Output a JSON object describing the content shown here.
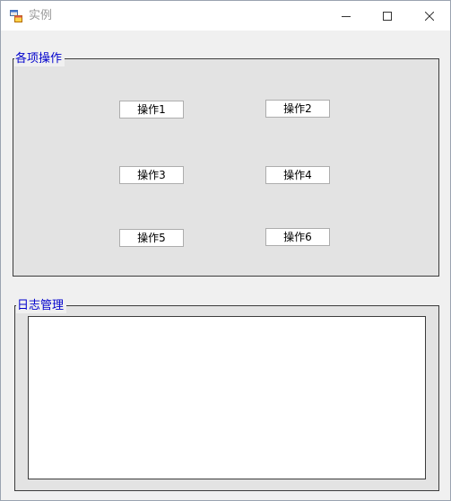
{
  "window": {
    "title": "实例"
  },
  "operations_group": {
    "legend": "各项操作",
    "buttons": [
      {
        "label": "操作1"
      },
      {
        "label": "操作2"
      },
      {
        "label": "操作3"
      },
      {
        "label": "操作4"
      },
      {
        "label": "操作5"
      },
      {
        "label": "操作6"
      }
    ]
  },
  "log_group": {
    "legend": "日志管理",
    "log_text": ""
  },
  "colors": {
    "legend_text": "#0000cc",
    "group_background": "#e3e3e3",
    "window_background": "#f0f0f0"
  },
  "icons": {
    "app": "app-window-icon",
    "minimize": "minimize-icon",
    "maximize": "maximize-icon",
    "close": "close-icon"
  }
}
